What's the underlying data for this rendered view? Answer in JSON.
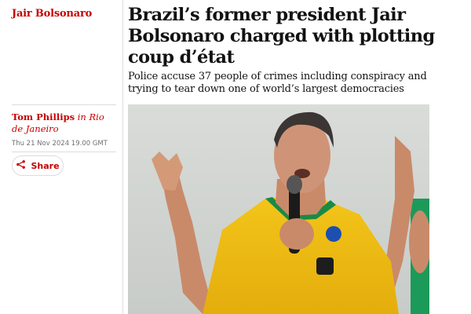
{
  "section": {
    "label": "Jair Bolsonaro"
  },
  "article": {
    "headline": "Brazil’s former president Jair Bolsonaro charged with plotting coup d’état",
    "standfirst": "Police accuse 37 people of crimes including conspiracy and trying to tear down one of world’s largest democracies",
    "author": "Tom Phillips",
    "location": "in Rio de Janeiro",
    "dateline": "Thu 21 Nov 2024 19.00 GMT"
  },
  "actions": {
    "share_label": "Share"
  },
  "icons": {
    "share": "share-icon"
  },
  "colors": {
    "accent": "#c70000",
    "text": "#121212",
    "muted": "#707070",
    "rule": "#dcdcdc"
  },
  "image": {
    "subject": "main-photo"
  }
}
